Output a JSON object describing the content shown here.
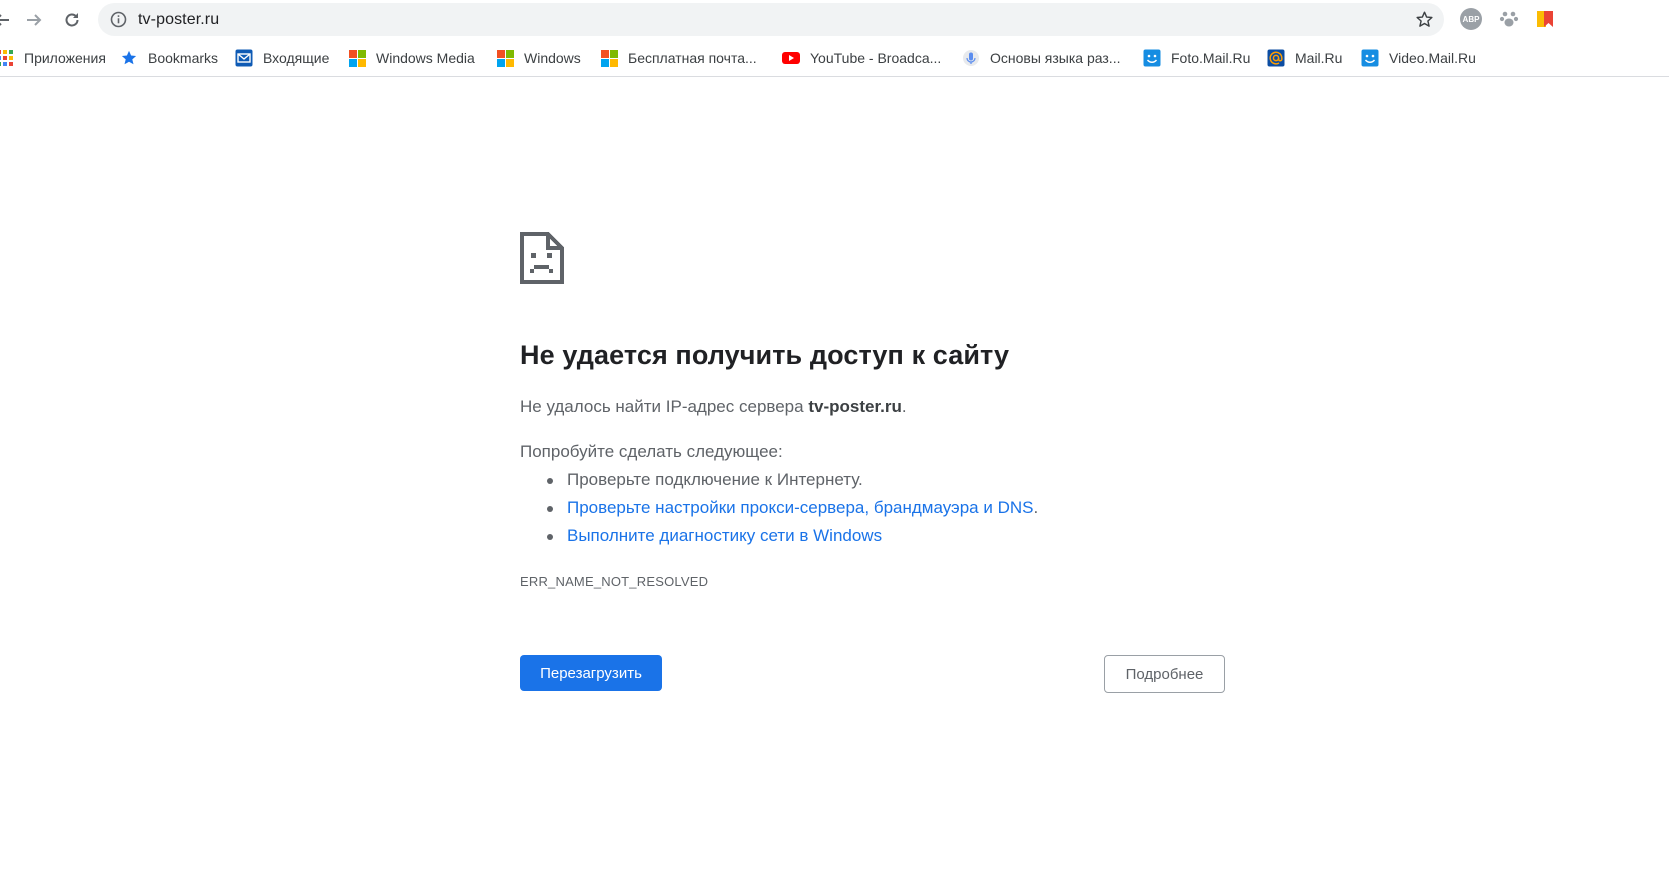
{
  "toolbar": {
    "url": "tv-poster.ru",
    "back_icon": "back-arrow-icon",
    "forward_icon": "forward-arrow-icon",
    "reload_icon": "reload-icon",
    "info_icon": "info-icon",
    "star_icon": "star-icon",
    "extensions": [
      {
        "name": "adblock-plus-icon",
        "text": "ABP"
      },
      {
        "name": "paw-extension-icon"
      },
      {
        "name": "bookmark-flag-extension-icon"
      }
    ]
  },
  "bookmarks": [
    {
      "label": "Приложения",
      "icon": "apps-grid-icon"
    },
    {
      "label": "Bookmarks",
      "icon": "star-icon"
    },
    {
      "label": "Входящие",
      "icon": "mail-icon"
    },
    {
      "label": "Windows Media",
      "icon": "windows-logo-icon"
    },
    {
      "label": "Windows",
      "icon": "windows-logo-icon"
    },
    {
      "label": "Бесплатная почта...",
      "icon": "windows-logo-icon"
    },
    {
      "label": "YouTube - Broadca...",
      "icon": "youtube-icon"
    },
    {
      "label": "Основы языка раз...",
      "icon": "mic-icon"
    },
    {
      "label": "Foto.Mail.Ru",
      "icon": "smiley-icon"
    },
    {
      "label": "Mail.Ru",
      "icon": "at-sign-icon"
    },
    {
      "label": "Video.Mail.Ru",
      "icon": "smiley-icon"
    }
  ],
  "error": {
    "icon": "sad-page-icon",
    "heading": "Не удается получить доступ к сайту",
    "line1_prefix": "Не удалось найти IP-адрес сервера ",
    "line1_host": "tv-poster.ru",
    "line1_suffix": ".",
    "try_heading": "Попробуйте сделать следующее:",
    "suggestion1": "Проверьте подключение к Интернету.",
    "suggestion2_link": "Проверьте настройки прокси-сервера, брандмауэра и DNS",
    "suggestion2_suffix": ".",
    "suggestion3_link": "Выполните диагностику сети в Windows",
    "code": "ERR_NAME_NOT_RESOLVED",
    "reload_label": "Перезагрузить",
    "details_label": "Подробнее"
  },
  "colors": {
    "accent": "#1a73e8",
    "text_secondary": "#5f6368",
    "heading": "#202124"
  }
}
